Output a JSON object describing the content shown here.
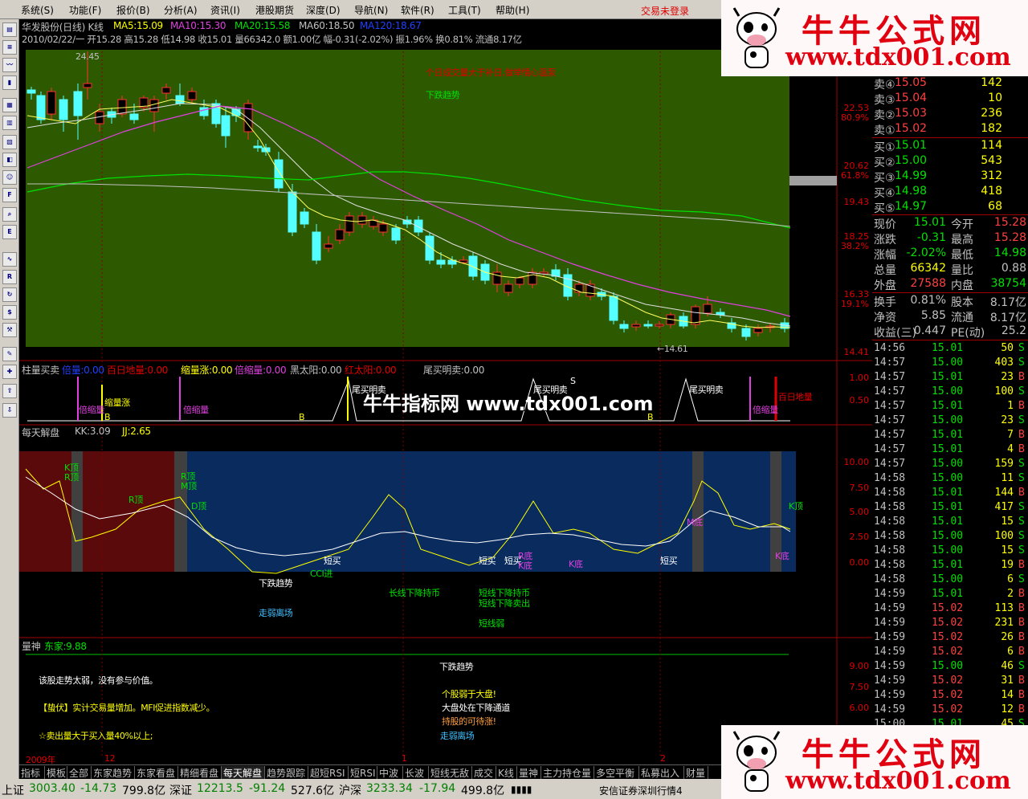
{
  "menu": [
    "系统(S)",
    "功能(F)",
    "报价(B)",
    "分析(A)",
    "资讯(I)",
    "港股期货",
    "深度(D)",
    "导航(N)",
    "软件(R)",
    "工具(T)",
    "帮助(H)"
  ],
  "trade_status": "交易未登录",
  "stock": {
    "title": "华发股份(日线) K线",
    "ma5": "MA5:15.09",
    "ma10": "MA10:15.30",
    "ma20": "MA20:15.58",
    "ma60": "MA60:18.50",
    "ma120": "MA120:18.67",
    "info": "2010/02/22/一 开15.28 高15.28 低14.98 收15.01 量66342.0 额1.00亿 幅-0.31(-2.02%) 振1.96% 换0.81% 流通8.17亿",
    "high_label": "24.45",
    "low_label": "←14.61",
    "annot1": "个日成交量大于补日,做举情心温泵",
    "annot2": "下跌趋势"
  },
  "price_scale": [
    "22.53",
    "80.9%",
    "20.62",
    "61.8%",
    "19.43",
    "18.25",
    "38.2%",
    "16.33",
    "19.1%",
    "14.41"
  ],
  "p2": {
    "name": "柱量买卖",
    "v1": "倍量:0.00",
    "v2": "百日地量:0.00",
    "v3": "缩量涨:0.00",
    "v4": "倍缩量:0.00",
    "v5": "黑太阳:0.00",
    "v6": "红太阳:0.00",
    "v7": "尾买明卖:0.00",
    "scale": [
      "1.00",
      "0.50"
    ],
    "labels": [
      "倍缩量",
      "缩量涨",
      "B",
      "倍缩量",
      "B",
      "尾买明卖",
      "尾买明卖",
      "尾买明卖",
      "S",
      "B",
      "倍缩量",
      "百日地量"
    ]
  },
  "p3": {
    "name": "每天解盘",
    "kk": "KK:3.09",
    "jj": "JJ:2.65",
    "scale": [
      "10.00",
      "7.50",
      "5.00",
      "2.50",
      "0.00"
    ],
    "labels": [
      "K顶",
      "R顶",
      "R顶",
      "R顶",
      "M顶",
      "D顶",
      "短买",
      "CCI进",
      "下跌趋势",
      "走弱离场",
      "长线下降持币",
      "短线下降持币",
      "短线下降卖出",
      "短线弱",
      "短买",
      "短买",
      "R底",
      "K底",
      "K底",
      "短买",
      "M底",
      "K顶",
      "K底"
    ]
  },
  "p4": {
    "name": "量神",
    "v": "东家:9.88",
    "scale": [
      "9.00",
      "7.50",
      "6.00"
    ],
    "lines": [
      "下跌趋势",
      "该股走势太弱，没有参与价值。",
      "【蛰伏】实计交易量增加。MFI促进指数减少。",
      "个股弱于大盘!",
      "大盘处在下降通道",
      "持股的可待涨!",
      "☆卖出量大于买入量40%以上;",
      "走弱离场"
    ]
  },
  "dates": [
    "2009年",
    "12",
    "1",
    "2"
  ],
  "watermark": "牛牛指标网 www.tdx001.com",
  "ad": {
    "title": "牛牛公式网",
    "url": "www.tdx001.com"
  },
  "quote": {
    "asks": [
      [
        "卖④",
        "15.05",
        "142"
      ],
      [
        "卖③",
        "15.04",
        "10"
      ],
      [
        "卖②",
        "15.03",
        "236"
      ],
      [
        "卖①",
        "15.02",
        "182"
      ]
    ],
    "bids": [
      [
        "买①",
        "15.01",
        "114"
      ],
      [
        "买②",
        "15.00",
        "543"
      ],
      [
        "买③",
        "14.99",
        "312"
      ],
      [
        "买④",
        "14.98",
        "418"
      ],
      [
        "买⑤",
        "14.97",
        "68"
      ]
    ],
    "stats": [
      [
        "现价",
        "15.01",
        "今开",
        "15.28"
      ],
      [
        "涨跌",
        "-0.31",
        "最高",
        "15.28"
      ],
      [
        "涨幅",
        "-2.02%",
        "最低",
        "14.98"
      ],
      [
        "总量",
        "66342",
        "量比",
        "0.88"
      ],
      [
        "外盘",
        "27588",
        "内盘",
        "38754"
      ],
      [
        "换手",
        "0.81%",
        "股本",
        "8.17亿"
      ],
      [
        "净资",
        "5.85",
        "流通",
        "8.17亿"
      ],
      [
        "收益(三)",
        "0.447",
        "PE(动)",
        "25.2"
      ]
    ],
    "ticks": [
      [
        "14:56",
        "15.01",
        "50",
        "S"
      ],
      [
        "14:57",
        "15.00",
        "403",
        "S"
      ],
      [
        "14:57",
        "15.01",
        "23",
        "B"
      ],
      [
        "14:57",
        "15.00",
        "100",
        "S"
      ],
      [
        "14:57",
        "15.01",
        "1",
        "B"
      ],
      [
        "14:57",
        "15.00",
        "23",
        "S"
      ],
      [
        "14:57",
        "15.01",
        "7",
        "B"
      ],
      [
        "14:57",
        "15.01",
        "4",
        "B"
      ],
      [
        "14:57",
        "15.00",
        "159",
        "S"
      ],
      [
        "14:58",
        "15.00",
        "11",
        "S"
      ],
      [
        "14:58",
        "15.01",
        "144",
        "B"
      ],
      [
        "14:58",
        "15.01",
        "417",
        "S"
      ],
      [
        "14:58",
        "15.01",
        "15",
        "S"
      ],
      [
        "14:58",
        "15.00",
        "100",
        "S"
      ],
      [
        "14:58",
        "15.00",
        "15",
        "S"
      ],
      [
        "14:58",
        "15.01",
        "19",
        "B"
      ],
      [
        "14:58",
        "15.00",
        "6",
        "S"
      ],
      [
        "14:59",
        "15.01",
        "2",
        "B"
      ],
      [
        "14:59",
        "15.02",
        "113",
        "B"
      ],
      [
        "14:59",
        "15.02",
        "231",
        "B"
      ],
      [
        "14:59",
        "15.02",
        "26",
        "B"
      ],
      [
        "14:59",
        "15.02",
        "6",
        "B"
      ],
      [
        "14:59",
        "15.00",
        "46",
        "S"
      ],
      [
        "14:59",
        "15.02",
        "31",
        "B"
      ],
      [
        "14:59",
        "15.02",
        "14",
        "B"
      ],
      [
        "14:59",
        "15.02",
        "12",
        "B"
      ],
      [
        "15:00",
        "15.01",
        "45",
        "S"
      ]
    ]
  },
  "tabs": [
    "指标",
    "模板",
    "全部",
    "东家趋势",
    "东家看盘",
    "精细看盘",
    "每天解盘",
    "趋势跟踪",
    "超短RSI",
    "短RSI",
    "中波",
    "长波",
    "短线无敌",
    "成交",
    "K线",
    "量神",
    "主力持仓量",
    "多空平衡",
    "私募出入",
    "财量"
  ],
  "status": {
    "sh": "上证",
    "sh_v": "3003.40",
    "sh_c": "-14.73",
    "sh_a": "799.8亿",
    "sz": "深证",
    "sz_v": "12213.5",
    "sz_c": "-91.24",
    "sz_a": "527.6亿",
    "hs": "沪深",
    "hs_v": "3233.34",
    "hs_c": "-17.94",
    "hs_a": "499.8亿",
    "broker": "安信证券深圳行情4"
  }
}
